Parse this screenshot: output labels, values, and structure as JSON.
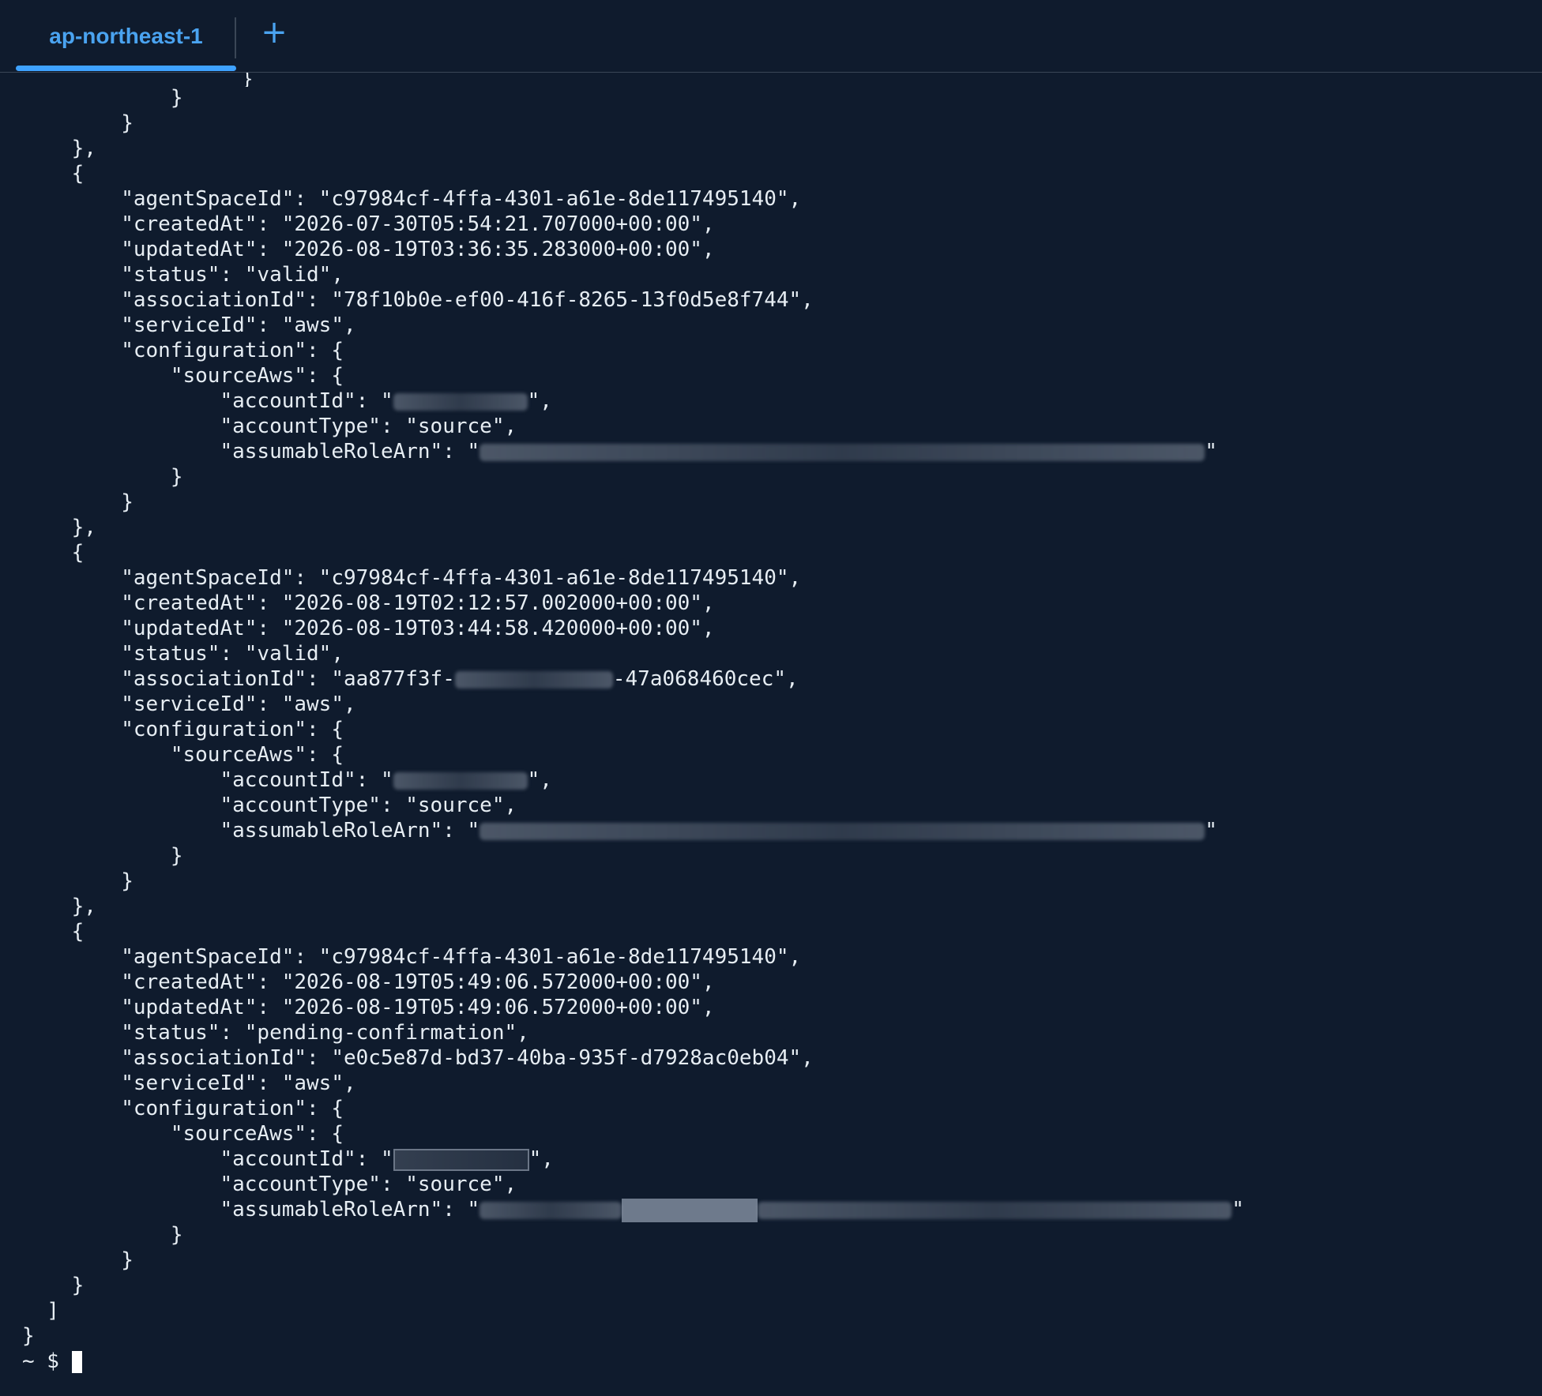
{
  "tab": {
    "label": "ap-northeast-1",
    "add_label": "+"
  },
  "terminal": {
    "lines": [
      "            }",
      "        }",
      "    },",
      "    {",
      "        \"agentSpaceId\": \"c97984cf-4ffa-4301-a61e-8de117495140\",",
      "        \"createdAt\": \"2026-07-30T05:54:21.707000+00:00\",",
      "        \"updatedAt\": \"2026-08-19T03:36:35.283000+00:00\",",
      "        \"status\": \"valid\",",
      "        \"associationId\": \"78f10b0e-ef00-416f-8265-13f0d5e8f744\",",
      "        \"serviceId\": \"aws\",",
      "        \"configuration\": {",
      "            \"sourceAws\": {",
      "                \"accountId\": \"",
      "                \"accountType\": \"source\",",
      "                \"assumableRoleArn\": \"",
      "            }",
      "        }",
      "    },",
      "    {",
      "        \"agentSpaceId\": \"c97984cf-4ffa-4301-a61e-8de117495140\",",
      "        \"createdAt\": \"2026-08-19T02:12:57.002000+00:00\",",
      "        \"updatedAt\": \"2026-08-19T03:44:58.420000+00:00\",",
      "        \"status\": \"valid\",",
      "        \"associationId\": \"aa877f3f-",
      "        \"serviceId\": \"aws\",",
      "        \"configuration\": {",
      "            \"sourceAws\": {",
      "                \"accountId\": \"",
      "                \"accountType\": \"source\",",
      "                \"assumableRoleArn\": \"",
      "            }",
      "        }",
      "    },",
      "    {",
      "        \"agentSpaceId\": \"c97984cf-4ffa-4301-a61e-8de117495140\",",
      "        \"createdAt\": \"2026-08-19T05:49:06.572000+00:00\",",
      "        \"updatedAt\": \"2026-08-19T05:49:06.572000+00:00\",",
      "        \"status\": \"pending-confirmation\",",
      "        \"associationId\": \"e0c5e87d-bd37-40ba-935f-d7928ac0eb04\",",
      "        \"serviceId\": \"aws\",",
      "        \"configuration\": {",
      "            \"sourceAws\": {",
      "                \"accountId\": \"",
      "                \"accountType\": \"source\",",
      "                \"assumableRoleArn\": \"",
      "            }",
      "        }",
      "    }",
      "  ]",
      "}",
      "~ $ "
    ],
    "tail": {
      "accountId_close": "\",",
      "roleArn_close": "\"",
      "associationId_tail": "-47a068460cec\","
    }
  },
  "colors": {
    "background": "#0f1b2d",
    "text": "#e6edf3",
    "accent": "#3ea2ff"
  }
}
